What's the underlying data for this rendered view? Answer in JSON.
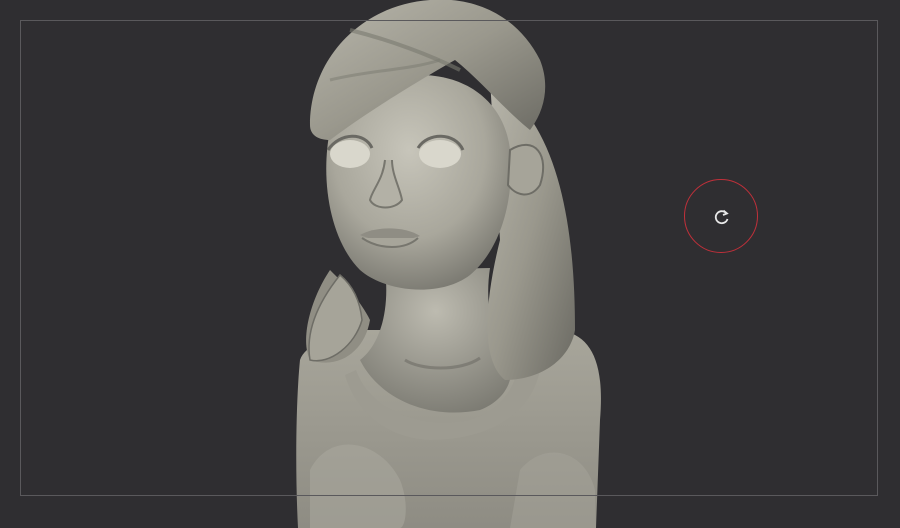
{
  "viewport": {
    "background_color": "#2f2e31",
    "frame_border_color": "#5a595c"
  },
  "model": {
    "subject": "sculpted-female-bust",
    "base_color": "#a9a79c",
    "hair_color": "#9d9b90",
    "shadow_color": "#55544e"
  },
  "cursor": {
    "icon": "rotate-icon",
    "ring_color": "#c0303a",
    "glyph_color": "#e8e8e8"
  }
}
